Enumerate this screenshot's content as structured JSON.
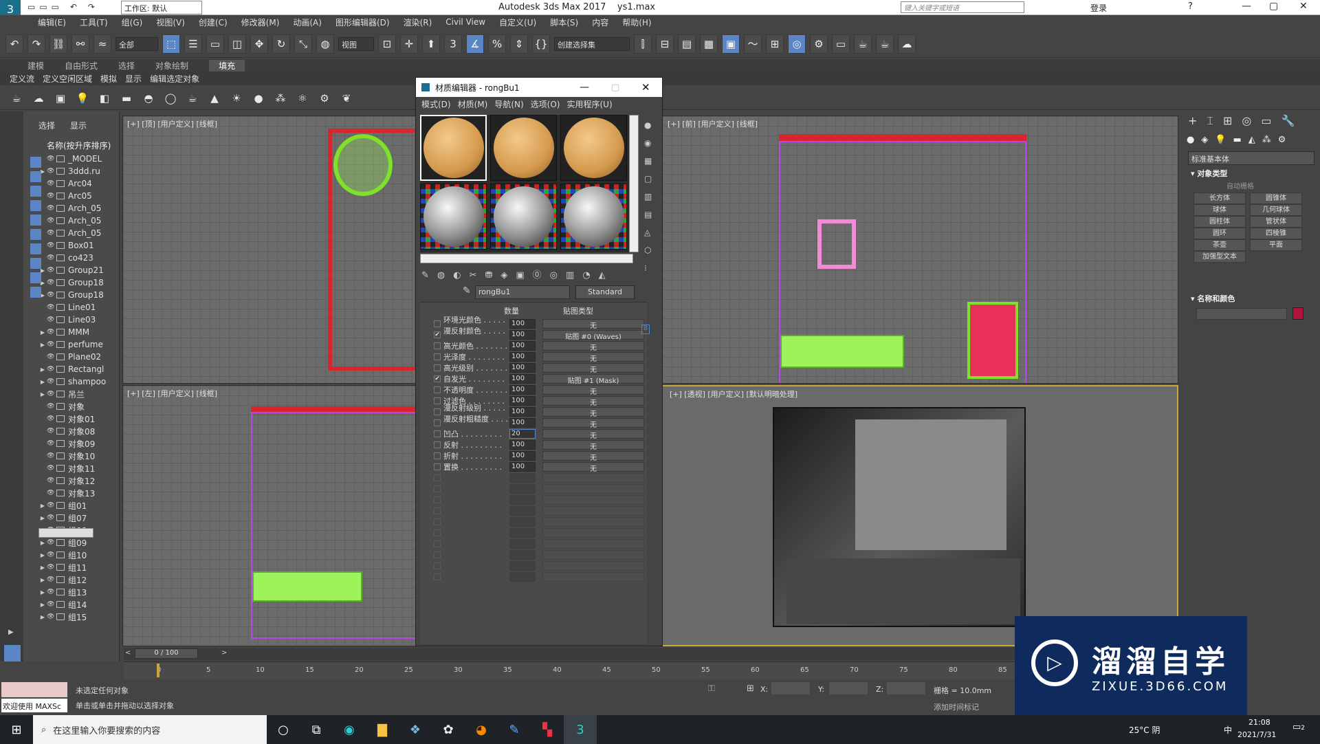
{
  "titlebar": {
    "workspace": "工作区: 默认",
    "app_title": "Autodesk 3ds Max 2017",
    "file": "ys1.max",
    "search_placeholder": "键入关键字或短语",
    "login": "登录"
  },
  "menubar": [
    "编辑(E)",
    "工具(T)",
    "组(G)",
    "视图(V)",
    "创建(C)",
    "修改器(M)",
    "动画(A)",
    "图形编辑器(D)",
    "渲染(R)",
    "Civil View",
    "自定义(U)",
    "脚本(S)",
    "内容",
    "帮助(H)"
  ],
  "toolbar": {
    "filter": "全部",
    "view": "视图",
    "selection_set": "创建选择集"
  },
  "ribbon_tabs": [
    "建模",
    "自由形式",
    "选择",
    "对象绘制",
    "填充"
  ],
  "ribbon_sub": [
    "定义流",
    "定义空闲区域",
    "模拟",
    "显示",
    "编辑选定对象"
  ],
  "scene": {
    "tabs": [
      "选择",
      "显示"
    ],
    "header": "名称(按升序排序)",
    "items": [
      "_MODEL",
      "3ddd.ru",
      "Arc04",
      "Arc05",
      "Arch_05",
      "Arch_05",
      "Arch_05",
      "Box01",
      "co423",
      "Group21",
      "Group18",
      "Group18",
      "Line01",
      "Line03",
      "MMM",
      "perfume",
      "Plane02",
      "Rectangl",
      "shampoo",
      "吊兰",
      "对象",
      "对象01",
      "对象08",
      "对象09",
      "对象10",
      "对象11",
      "对象12",
      "对象13",
      "组01",
      "组07",
      "组08",
      "组09",
      "组10",
      "组11",
      "组12",
      "组13",
      "组14",
      "组15"
    ]
  },
  "viewports": {
    "top": "[+] [顶] [用户定义] [线框]",
    "front": "[+] [前] [用户定义] [线框]",
    "left": "[+] [左] [用户定义] [线框]",
    "persp": "[+] [透视] [用户定义] [默认明暗处理]"
  },
  "material_editor": {
    "title": "材质编辑器 - rongBu1",
    "menu": [
      "模式(D)",
      "材质(M)",
      "导航(N)",
      "选项(O)",
      "实用程序(U)"
    ],
    "material_name": "rongBu1",
    "material_type": "Standard",
    "col_amount": "数量",
    "col_maptype": "贴图类型",
    "params": [
      {
        "label": "环境光颜色 . . . . . .",
        "checked": false,
        "amount": "100",
        "map": "无"
      },
      {
        "label": "漫反射颜色 . . . . . .",
        "checked": true,
        "amount": "100",
        "map": "贴图 #0 (Waves)"
      },
      {
        "label": "高光颜色 . . . . . . .",
        "checked": false,
        "amount": "100",
        "map": "无"
      },
      {
        "label": "光泽度 . . . . . . . .",
        "checked": false,
        "amount": "100",
        "map": "无"
      },
      {
        "label": "高光级别 . . . . . . .",
        "checked": false,
        "amount": "100",
        "map": "无"
      },
      {
        "label": "自发光 . . . . . . . .",
        "checked": true,
        "amount": "100",
        "map": "贴图 #1 (Mask)"
      },
      {
        "label": "不透明度 . . . . . . .",
        "checked": false,
        "amount": "100",
        "map": "无"
      },
      {
        "label": "过滤色 . . . . . . . .",
        "checked": false,
        "amount": "100",
        "map": "无"
      },
      {
        "label": "漫反射级别 . . . . . .",
        "checked": false,
        "amount": "100",
        "map": "无"
      },
      {
        "label": "漫反射粗糙度 . . . . .",
        "checked": false,
        "amount": "100",
        "map": "无"
      },
      {
        "label": "凹凸 . . . . . . . . .",
        "checked": false,
        "amount": "20",
        "map": "无"
      },
      {
        "label": "反射 . . . . . . . . .",
        "checked": false,
        "amount": "100",
        "map": "无"
      },
      {
        "label": "折射 . . . . . . . . .",
        "checked": false,
        "amount": "100",
        "map": "无"
      },
      {
        "label": "置换 . . . . . . . . .",
        "checked": false,
        "amount": "100",
        "map": "无"
      }
    ]
  },
  "command_panel": {
    "dropdown": "标准基本体",
    "object_type": "对象类型",
    "autogrid": "自动栅格",
    "buttons": [
      "长方体",
      "圆锥体",
      "球体",
      "几何球体",
      "圆柱体",
      "管状体",
      "圆环",
      "四棱锥",
      "茶壶",
      "平面",
      "加强型文本"
    ],
    "name_color": "名称和颜色"
  },
  "timeline": {
    "frame": "0 / 100",
    "ticks": [
      "0",
      "5",
      "10",
      "15",
      "20",
      "25",
      "30",
      "35",
      "40",
      "45",
      "50",
      "55",
      "60",
      "65",
      "70",
      "75",
      "80",
      "85"
    ]
  },
  "status": {
    "maxscript": "欢迎使用 MAXSc",
    "line1": "未选定任何对象",
    "line2": "单击或单击并拖动以选择对象",
    "x_label": "X:",
    "y_label": "Y:",
    "z_label": "Z:",
    "grid": "栅格 = 10.0mm",
    "add_time_tag": "添加时间标记"
  },
  "taskbar": {
    "search_placeholder": "在这里输入你要搜索的内容",
    "weather": "25°C 阴",
    "time": "21:08",
    "date": "2021/7/31",
    "lang": "中",
    "notif": "2"
  },
  "watermark": {
    "brand": "溜溜自学",
    "url": "ZIXUE.3D66.COM"
  }
}
